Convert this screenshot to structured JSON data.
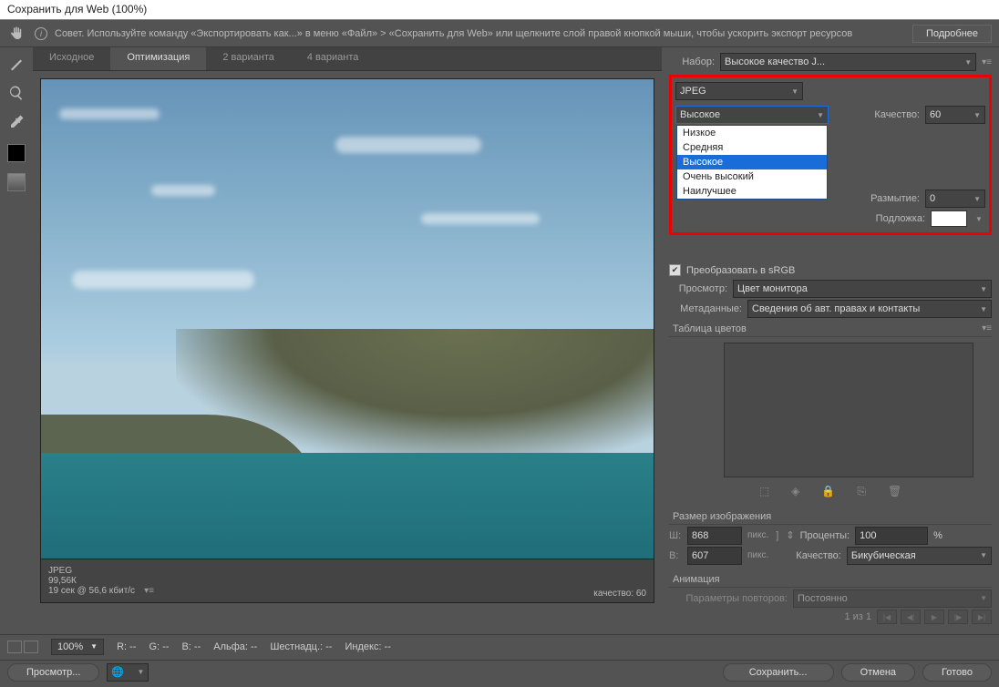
{
  "title": "Сохранить для Web (100%)",
  "tip": {
    "text": "Совет. Используйте команду «Экспортировать как...» в меню «Файл» > «Сохранить для Web» или щелкните слой правой кнопкой мыши, чтобы ускорить экспорт ресурсов",
    "more": "Подробнее"
  },
  "tabs": {
    "source": "Исходное",
    "optimize": "Оптимизация",
    "two_up": "2 варианта",
    "four_up": "4 варианта"
  },
  "preview_info": {
    "format": "JPEG",
    "size": "99,56К",
    "time": "19 сек @ 56,6 кбит/с",
    "quality_label": "качество: 60"
  },
  "preset": {
    "label": "Набор:",
    "value": "Высокое качество J..."
  },
  "format": {
    "value": "JPEG"
  },
  "quality_preset": {
    "value": "Высокое",
    "options": [
      "Низкое",
      "Средняя",
      "Высокое",
      "Очень высокий",
      "Наилучшее"
    ]
  },
  "quality": {
    "label": "Качество:",
    "value": "60"
  },
  "blur": {
    "label": "Размытие:",
    "value": "0"
  },
  "matte": {
    "label": "Подложка:"
  },
  "srgb": {
    "label": "Преобразовать в sRGB",
    "checked": true
  },
  "preview": {
    "label": "Просмотр:",
    "value": "Цвет монитора"
  },
  "metadata": {
    "label": "Метаданные:",
    "value": "Сведения об авт. правах и контакты"
  },
  "palette": {
    "title": "Таблица цветов"
  },
  "image_size": {
    "title": "Размер изображения",
    "w_label": "Ш:",
    "w": "868",
    "h_label": "В:",
    "h": "607",
    "px": "пикс.",
    "percent_label": "Проценты:",
    "percent": "100",
    "percent_unit": "%",
    "quality_label": "Качество:",
    "quality": "Бикубическая"
  },
  "animation": {
    "title": "Анимация",
    "loop_label": "Параметры повторов:",
    "loop_value": "Постоянно",
    "frame": "1 из 1"
  },
  "status": {
    "zoom": "100%",
    "r": "R: --",
    "g": "G: --",
    "b": "B: --",
    "alpha": "Альфа: --",
    "hex": "Шестнадц.: --",
    "index": "Индекс: --"
  },
  "footer": {
    "preview_btn": "Просмотр...",
    "save": "Сохранить...",
    "cancel": "Отмена",
    "done": "Готово"
  }
}
